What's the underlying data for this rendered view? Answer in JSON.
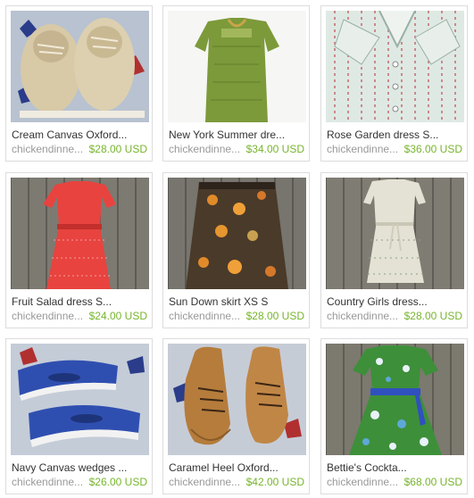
{
  "listings": [
    {
      "title": "Cream Canvas Oxford...",
      "shop": "chickendinne...",
      "price": "$28.00 USD",
      "image": "cream-oxford-shoes"
    },
    {
      "title": "New York Summer dre...",
      "shop": "chickendinne...",
      "price": "$34.00 USD",
      "image": "green-dress"
    },
    {
      "title": "Rose Garden dress S...",
      "shop": "chickendinne...",
      "price": "$36.00 USD",
      "image": "striped-collar-dress"
    },
    {
      "title": "Fruit Salad dress S...",
      "shop": "chickendinne...",
      "price": "$24.00 USD",
      "image": "red-print-dress"
    },
    {
      "title": "Sun Down skirt XS S",
      "shop": "chickendinne...",
      "price": "$28.00 USD",
      "image": "floral-skirt"
    },
    {
      "title": "Country Girls dress...",
      "shop": "chickendinne...",
      "price": "$28.00 USD",
      "image": "cream-dress"
    },
    {
      "title": "Navy Canvas wedges ...",
      "shop": "chickendinne...",
      "price": "$26.00 USD",
      "image": "navy-wedges"
    },
    {
      "title": "Caramel Heel Oxford...",
      "shop": "chickendinne...",
      "price": "$42.00 USD",
      "image": "caramel-oxfords"
    },
    {
      "title": "Bettie's Cockta...",
      "shop": "chickendinne...",
      "price": "$68.00 USD",
      "image": "blue-floral-dress"
    }
  ],
  "colors": {
    "price": "#77b52c",
    "title": "#333333",
    "shop": "#999999",
    "border": "#dcdcdc"
  }
}
